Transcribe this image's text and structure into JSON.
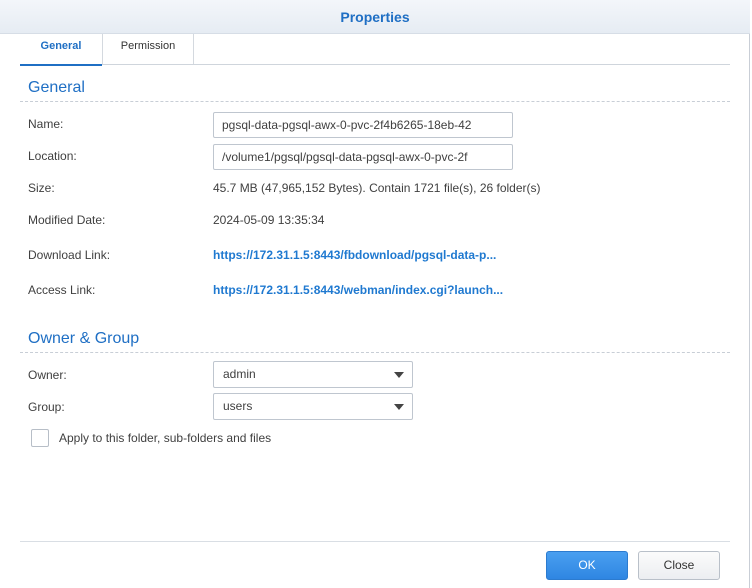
{
  "dialog": {
    "title": "Properties"
  },
  "tabs": [
    {
      "label": "General",
      "active": true
    },
    {
      "label": "Permission",
      "active": false
    }
  ],
  "general": {
    "section_title": "General",
    "name_label": "Name:",
    "name_value": "pgsql-data-pgsql-awx-0-pvc-2f4b6265-18eb-42",
    "location_label": "Location:",
    "location_value": "/volume1/pgsql/pgsql-data-pgsql-awx-0-pvc-2f",
    "size_label": "Size:",
    "size_value": "45.7 MB (47,965,152 Bytes). Contain 1721 file(s), 26 folder(s)",
    "modified_label": "Modified Date:",
    "modified_value": "2024-05-09 13:35:34",
    "download_label": "Download Link:",
    "download_value": "https://172.31.1.5:8443/fbdownload/pgsql-data-p...",
    "access_label": "Access Link:",
    "access_value": "https://172.31.1.5:8443/webman/index.cgi?launch..."
  },
  "owner_group": {
    "section_title": "Owner & Group",
    "owner_label": "Owner:",
    "owner_value": "admin",
    "group_label": "Group:",
    "group_value": "users",
    "apply_label": "Apply to this folder, sub-folders and files",
    "apply_checked": false
  },
  "buttons": {
    "ok": "OK",
    "close": "Close"
  },
  "colors": {
    "accent": "#1f6fc4",
    "link": "#1f79d0",
    "primary_button": "#2f86e2"
  }
}
